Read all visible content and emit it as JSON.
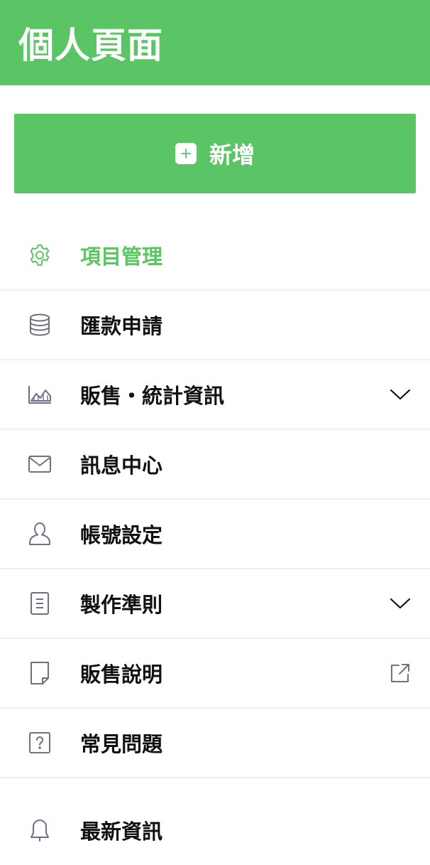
{
  "header": {
    "title": "個人頁面"
  },
  "add_button": {
    "label": "新增",
    "icon": "plus-square-icon"
  },
  "colors": {
    "accent": "#5bc464",
    "icon": "#6b7285",
    "text": "#111111",
    "divider": "#efefef"
  },
  "menu": {
    "items": [
      {
        "label": "項目管理",
        "icon": "gear-icon",
        "active": true
      },
      {
        "label": "匯款申請",
        "icon": "database-icon"
      },
      {
        "label": "販售・統計資訊",
        "icon": "chart-icon",
        "trailing": "chevron-down-icon"
      },
      {
        "label": "訊息中心",
        "icon": "mail-icon"
      },
      {
        "label": "帳號設定",
        "icon": "user-icon"
      },
      {
        "label": "製作準則",
        "icon": "document-icon",
        "trailing": "chevron-down-icon"
      },
      {
        "label": "販售說明",
        "icon": "note-icon",
        "trailing": "external-link-icon"
      },
      {
        "label": "常見問題",
        "icon": "question-icon"
      },
      {
        "label": "最新資訊",
        "icon": "bell-icon"
      }
    ]
  }
}
